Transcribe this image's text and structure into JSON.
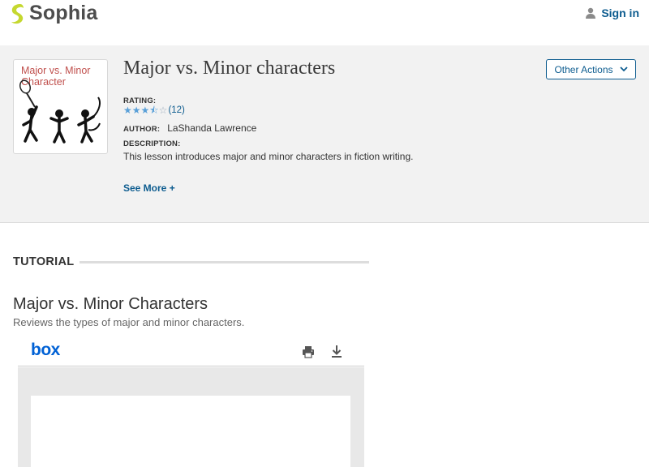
{
  "header": {
    "brand": "Sophia",
    "signin_label": "Sign in",
    "colors": {
      "brand_mark": "#c5d82f",
      "link": "#0d5c8f"
    }
  },
  "lesson": {
    "thumbnail_title": "Major vs. Minor Character",
    "title": "Major vs. Minor characters",
    "rating_label": "RATING:",
    "rating_value": 3.5,
    "rating_max": 5,
    "rating_count": "(12)",
    "author_label": "AUTHOR:",
    "author_name": "LaShanda Lawrence",
    "description_label": "DESCRIPTION:",
    "description": "This lesson introduces major and minor characters in fiction writing.",
    "see_more": "See More +",
    "other_actions": "Other Actions"
  },
  "tutorial": {
    "section_heading": "TUTORIAL",
    "title": "Major vs. Minor Characters",
    "subtitle": "Reviews the types of major and minor characters."
  },
  "viewer": {
    "brand": "box",
    "icons": [
      "print-icon",
      "download-icon"
    ]
  }
}
